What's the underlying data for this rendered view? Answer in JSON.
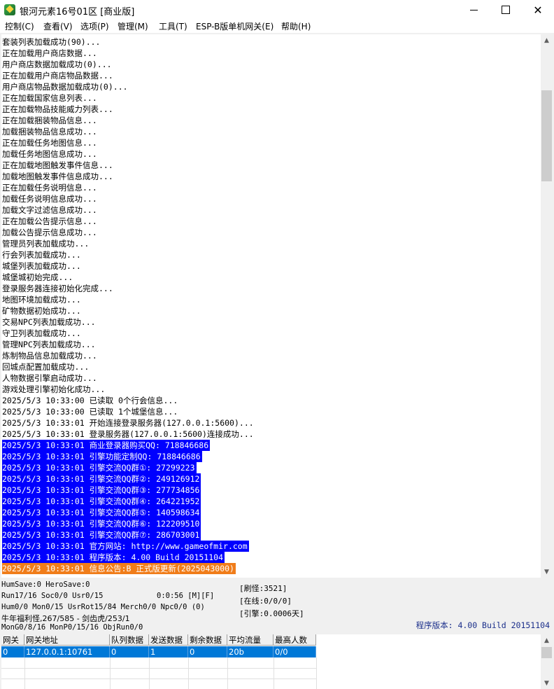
{
  "window": {
    "title": "银河元素16号01区 [商业版]",
    "minimize_glyph": "—",
    "close_glyph": "✕"
  },
  "menu": [
    "控制(C)",
    "查看(V)",
    "选项(P)",
    "管理(M)",
    "工具(T)",
    "ESP-B版单机网关(E)",
    "帮助(H)"
  ],
  "log": {
    "lines": [
      {
        "text": "套装列表加载成功(90)...",
        "style": ""
      },
      {
        "text": "正在加载用户商店数据...",
        "style": ""
      },
      {
        "text": "用户商店数据加载成功(0)...",
        "style": ""
      },
      {
        "text": "正在加载用户商店物品数据...",
        "style": ""
      },
      {
        "text": "用户商店物品数据加载成功(0)...",
        "style": ""
      },
      {
        "text": "正在加载国家信息列表...",
        "style": ""
      },
      {
        "text": "正在加载物品技能威力列表...",
        "style": ""
      },
      {
        "text": "正在加载捆装物品信息...",
        "style": ""
      },
      {
        "text": "加载捆装物品信息成功...",
        "style": ""
      },
      {
        "text": "正在加载任务地图信息...",
        "style": ""
      },
      {
        "text": "加载任务地图信息成功...",
        "style": ""
      },
      {
        "text": "正在加载地图触发事件信息...",
        "style": ""
      },
      {
        "text": "加载地图触发事件信息成功...",
        "style": ""
      },
      {
        "text": "正在加载任务说明信息...",
        "style": ""
      },
      {
        "text": "加载任务说明信息成功...",
        "style": ""
      },
      {
        "text": "加载文字过滤信息成功...",
        "style": ""
      },
      {
        "text": "正在加载公告提示信息...",
        "style": ""
      },
      {
        "text": "加载公告提示信息成功...",
        "style": ""
      },
      {
        "text": "管理员列表加载成功...",
        "style": ""
      },
      {
        "text": "行会列表加载成功...",
        "style": ""
      },
      {
        "text": "城堡列表加载成功...",
        "style": ""
      },
      {
        "text": "城堡城初始完成...",
        "style": ""
      },
      {
        "text": "登录服务器连接初始化完成...",
        "style": ""
      },
      {
        "text": "地图环境加载成功...",
        "style": ""
      },
      {
        "text": "矿物数据初始成功...",
        "style": ""
      },
      {
        "text": "交易NPC列表加载成功...",
        "style": ""
      },
      {
        "text": "守卫列表加载成功...",
        "style": ""
      },
      {
        "text": "管理NPC列表加载成功...",
        "style": ""
      },
      {
        "text": "炼制物品信息加载成功...",
        "style": ""
      },
      {
        "text": "回城点配置加载成功...",
        "style": ""
      },
      {
        "text": "人物数据引擎启动成功...",
        "style": ""
      },
      {
        "text": "游戏处理引擎初始化成功...",
        "style": ""
      },
      {
        "text": "2025/5/3 10:33:00 已读取 0个行会信息...",
        "style": ""
      },
      {
        "text": "2025/5/3 10:33:00 已读取 1个城堡信息...",
        "style": ""
      },
      {
        "text": "2025/5/3 10:33:01 开始连接登录服务器(127.0.0.1:5600)...",
        "style": ""
      },
      {
        "text": "2025/5/3 10:33:01 登录服务器(127.0.0.1:5600)连接成功...",
        "style": ""
      },
      {
        "text": "2025/5/3 10:33:01 商业登录器购买QQ: 718846686",
        "style": "hl"
      },
      {
        "text": "2025/5/3 10:33:01 引擎功能定制QQ: 718846686",
        "style": "hl"
      },
      {
        "text": "2025/5/3 10:33:01 引擎交流QQ群①: 27299223",
        "style": "hl"
      },
      {
        "text": "2025/5/3 10:33:01 引擎交流QQ群②: 249126912",
        "style": "hl"
      },
      {
        "text": "2025/5/3 10:33:01 引擎交流QQ群③: 277734856",
        "style": "hl"
      },
      {
        "text": "2025/5/3 10:33:01 引擎交流QQ群④: 264221952",
        "style": "hl"
      },
      {
        "text": "2025/5/3 10:33:01 引擎交流QQ群⑤: 140598634",
        "style": "hl"
      },
      {
        "text": "2025/5/3 10:33:01 引擎交流QQ群⑥: 122209510",
        "style": "hl"
      },
      {
        "text": "2025/5/3 10:33:01 引擎交流QQ群⑦: 286703001",
        "style": "hl"
      },
      {
        "text": "2025/5/3 10:33:01 官方网站: http://www.gameofmir.com",
        "style": "hl"
      },
      {
        "text": "2025/5/3 10:33:01 程序版本: 4.00 Build 20151104",
        "style": "hl"
      },
      {
        "text": "2025/5/3 10:33:01 信息公告:B 正式版更新(2025043000)",
        "style": "hl2"
      }
    ]
  },
  "status": {
    "line1": "HumSave:0 HeroSave:0",
    "line2": "Run17/16 Soc0/0 Usr0/15",
    "runtime": "0:0:56 [M][F]",
    "line3": "Hum0/0 Mon0/15 UsrRot15/84 Merch0/0 Npc0/0 (0)",
    "line4": "牛年福利怪,267/585 - 剑齿虎/253/1",
    "line5": "MonG0/8/16 MonP0/15/16 ObjRun0/0",
    "refresh": "[刷怪:3521]",
    "online": "[在线:0/0/0]",
    "engine": "[引擎:0.0006天]",
    "version": "程序版本: 4.00 Build 20151104"
  },
  "gateway": {
    "headers": [
      "网关",
      "网关地址",
      "队列数据",
      "发送数据",
      "剩余数据",
      "平均流量",
      "最高人数"
    ],
    "rows": [
      [
        "0",
        "127.0.0.1:10761",
        "0",
        "1",
        "0",
        "20b",
        "0/0"
      ]
    ]
  }
}
